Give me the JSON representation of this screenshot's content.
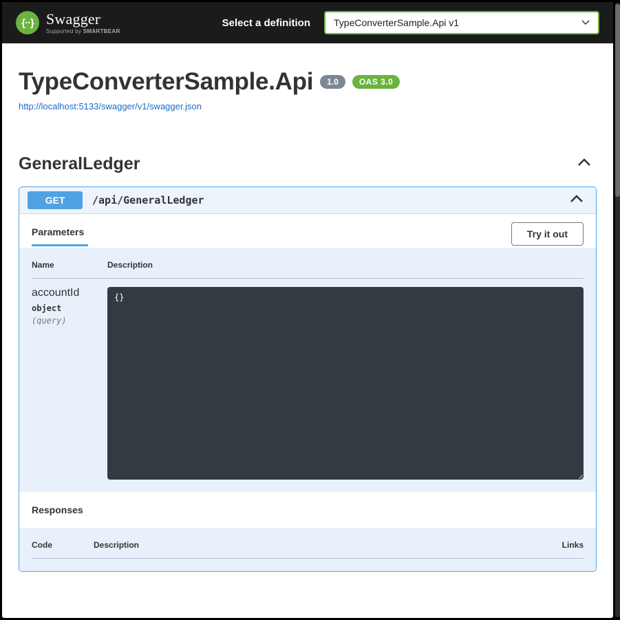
{
  "topbar": {
    "logo_braces": "{··}",
    "logo_main": "Swagger",
    "logo_sub_prefix": "Supported by ",
    "logo_sub_brand": "SMARTBEAR",
    "select_label": "Select a definition",
    "selected_definition": "TypeConverterSample.Api v1"
  },
  "api": {
    "title": "TypeConverterSample.Api",
    "version_badge": "1.0",
    "oas_badge": "OAS 3.0",
    "spec_url": "http://localhost:5133/swagger/v1/swagger.json"
  },
  "tag": {
    "name": "GeneralLedger"
  },
  "operation": {
    "method": "GET",
    "path": "/api/GeneralLedger",
    "parameters_tab": "Parameters",
    "try_it_out": "Try it out",
    "table": {
      "head_name": "Name",
      "head_desc": "Description",
      "rows": [
        {
          "name": "accountId",
          "type": "object",
          "in": "(query)",
          "schema": "{}"
        }
      ]
    },
    "responses_label": "Responses",
    "responses_table": {
      "head_code": "Code",
      "head_desc": "Description",
      "head_links": "Links"
    }
  }
}
